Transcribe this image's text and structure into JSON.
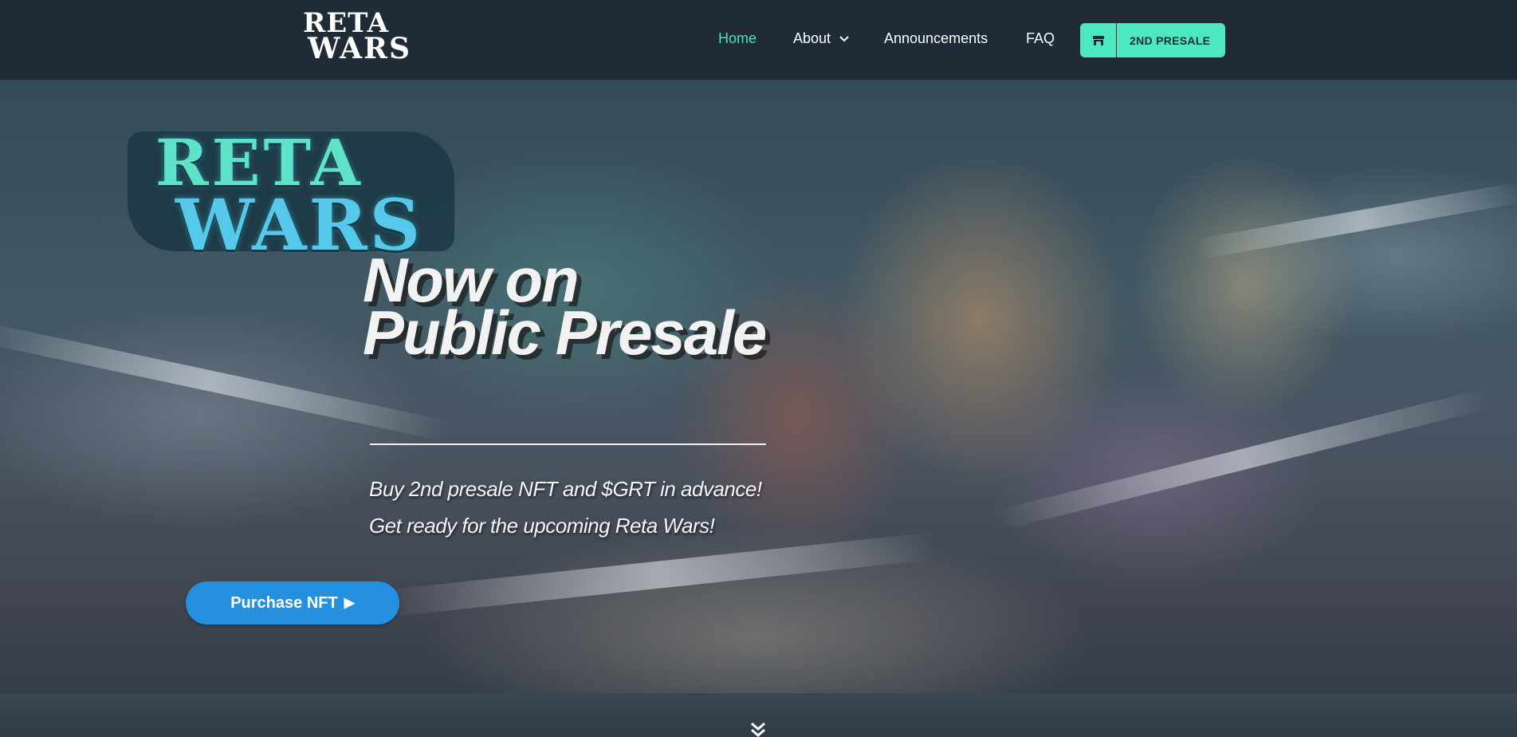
{
  "nav": {
    "logo_line1": "RETA",
    "logo_line2": "WARS",
    "items": [
      {
        "label": "Home",
        "active": true
      },
      {
        "label": "About",
        "has_dropdown": true
      },
      {
        "label": "Announcements"
      },
      {
        "label": "FAQ"
      }
    ],
    "presale_button": {
      "label": "2ND PRESALE",
      "icon": "store-icon"
    }
  },
  "hero": {
    "logo_line1": "RETA",
    "logo_line2": "WARS",
    "headline_line1": "Now on",
    "headline_line2": "Public Presale",
    "sub_line1": "Buy 2nd presale NFT and $GRT in advance!",
    "sub_line2": "Get ready for the upcoming Reta Wars!",
    "cta_label": "Purchase NFT",
    "cta_icon": "play-arrow-icon"
  },
  "scroll_icon": "double-chevron-down-icon",
  "colors": {
    "nav_bg": "#1f2b37",
    "accent": "#4de8c0",
    "active_link": "#4de2bf",
    "cta": "#2590e0"
  }
}
